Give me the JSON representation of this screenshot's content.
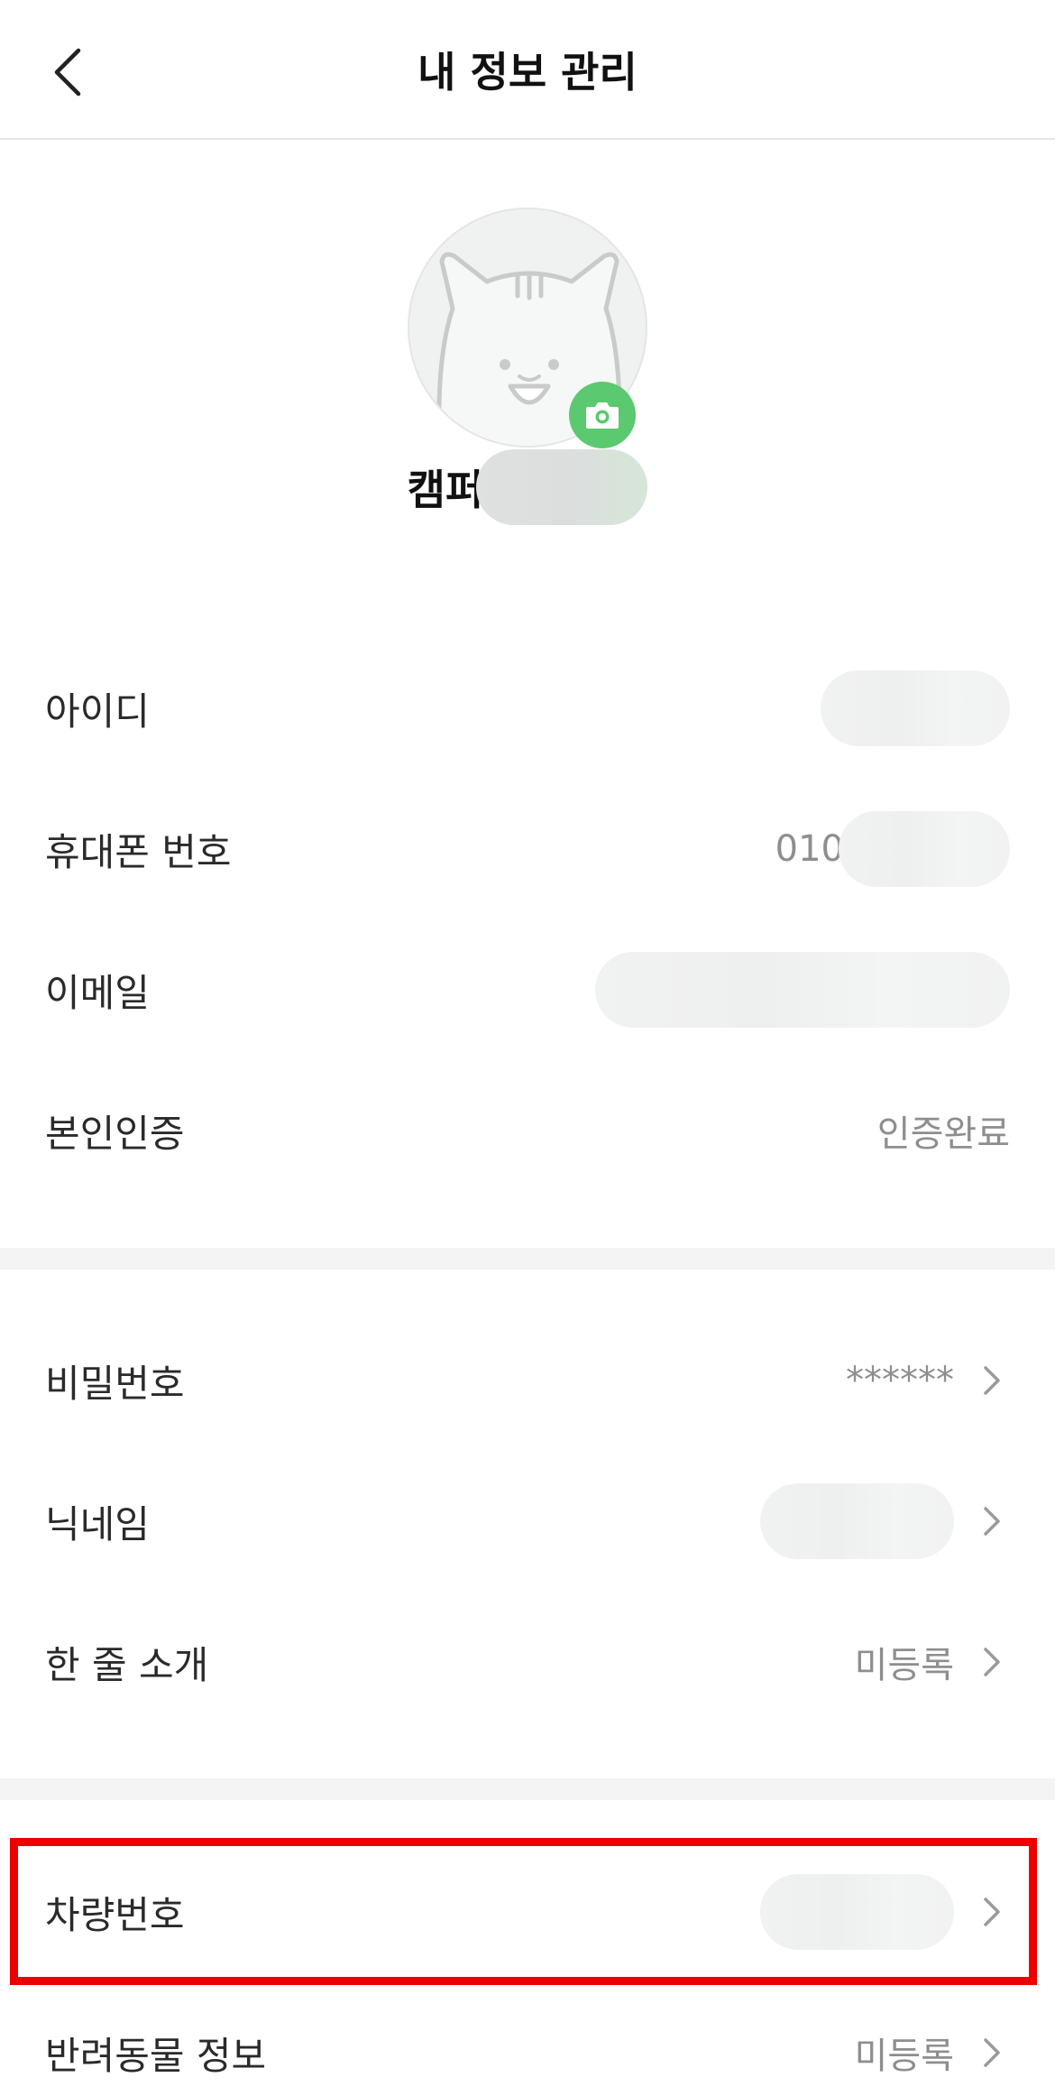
{
  "header": {
    "title": "내 정보 관리",
    "back_icon": "chevron-left-icon"
  },
  "profile": {
    "avatar_icon": "cat-avatar-icon",
    "camera_icon": "camera-icon",
    "camera_color": "#5bc96f",
    "name_prefix": "캠퍼"
  },
  "account_info": {
    "id_label": "아이디",
    "phone_label": "휴대폰 번호",
    "phone_prefix": "010",
    "email_label": "이메일",
    "verification_label": "본인인증",
    "verification_value": "인증완료"
  },
  "settings": {
    "password_label": "비밀번호",
    "password_value": "******",
    "nickname_label": "닉네임",
    "intro_label": "한 줄 소개",
    "intro_value": "미등록"
  },
  "extra": {
    "car_label": "차량번호",
    "pet_label": "반려동물 정보",
    "pet_value": "미등록"
  },
  "chevron_icon": "chevron-right-icon",
  "highlight_color": "#ee0000"
}
